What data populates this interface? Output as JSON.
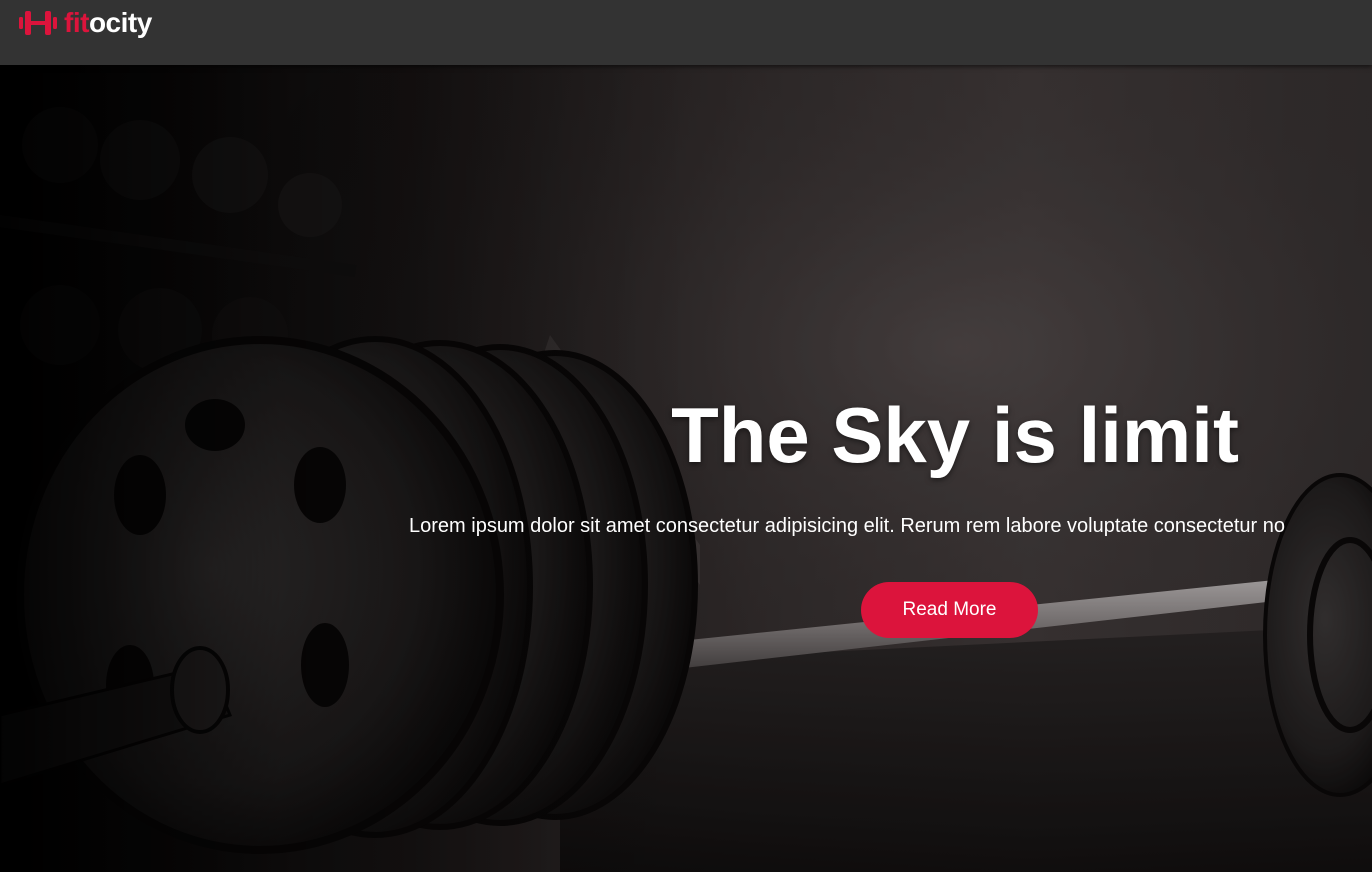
{
  "navbar": {
    "brand": {
      "icon": "dumbbell-icon",
      "accent_text": "fit",
      "rest_text": "ocity"
    }
  },
  "hero": {
    "title": "The Sky is limit",
    "text": "Lorem ipsum dolor sit amet consectetur adipisicing elit. Rerum rem labore voluptate consectetur no",
    "button_label": "Read More"
  },
  "colors": {
    "accent": "#dc143c",
    "navbar": "#333333",
    "text": "#ffffff"
  }
}
